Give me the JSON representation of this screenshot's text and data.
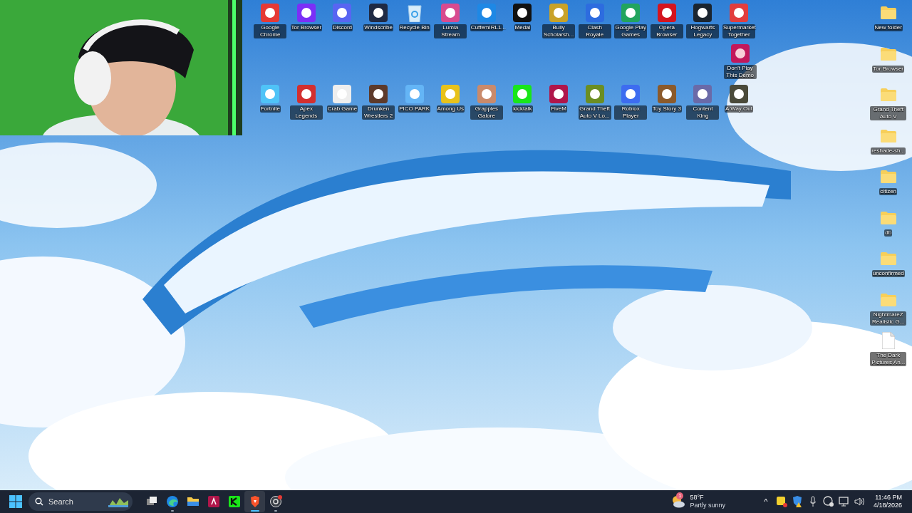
{
  "desktop": {
    "top_row": [
      {
        "label": "Google Chrome",
        "kind": "app"
      },
      {
        "label": "Tor Browser",
        "kind": "app"
      },
      {
        "label": "Discord",
        "kind": "app"
      },
      {
        "label": "Windscribe",
        "kind": "app"
      },
      {
        "label": "Recycle Bin",
        "kind": "recycle"
      },
      {
        "label": "Lumia Stream",
        "kind": "app"
      },
      {
        "label": "CuffemIRL1...",
        "kind": "app"
      },
      {
        "label": "Medal",
        "kind": "app"
      },
      {
        "label": "Bully Scholarsh...",
        "kind": "app"
      },
      {
        "label": "Clash Royale",
        "kind": "app"
      },
      {
        "label": "Google Play Games",
        "kind": "app"
      },
      {
        "label": "Opera Browser",
        "kind": "app"
      },
      {
        "label": "Hogwarts Legacy",
        "kind": "app"
      },
      {
        "label": "Supermarket Together",
        "kind": "app"
      }
    ],
    "middle_row": [
      {
        "label": "Don't Play This Demo",
        "kind": "app"
      }
    ],
    "bottom_row": [
      {
        "label": "Fortnite",
        "kind": "app"
      },
      {
        "label": "Apex Legends",
        "kind": "app"
      },
      {
        "label": "Crab Game",
        "kind": "app"
      },
      {
        "label": "Drunken Wrestlers 2",
        "kind": "app"
      },
      {
        "label": "PICO PARK",
        "kind": "app"
      },
      {
        "label": "Among Us",
        "kind": "app"
      },
      {
        "label": "Grapples Galore",
        "kind": "app"
      },
      {
        "label": "kicktalk",
        "kind": "app"
      },
      {
        "label": "FiveM",
        "kind": "app"
      },
      {
        "label": "Grand Theft Auto V Lo...",
        "kind": "app"
      },
      {
        "label": "Roblox Player",
        "kind": "app"
      },
      {
        "label": "Toy Story 3",
        "kind": "app"
      },
      {
        "label": "Content King",
        "kind": "app"
      },
      {
        "label": "A Way Out",
        "kind": "app"
      }
    ],
    "right_column": [
      {
        "label": "New folder",
        "kind": "folder"
      },
      {
        "label": "Tor Browser",
        "kind": "folder"
      },
      {
        "label": "Grand Theft Auto V",
        "kind": "folder"
      },
      {
        "label": "reshade-sh...",
        "kind": "folder"
      },
      {
        "label": "citizen",
        "kind": "folder"
      },
      {
        "label": "db",
        "kind": "folder"
      },
      {
        "label": "unconfirmed",
        "kind": "folder"
      },
      {
        "label": "NightmareZ Realistic G...",
        "kind": "folder"
      },
      {
        "label": "The Dark Pictures An...",
        "kind": "file"
      }
    ]
  },
  "taskbar": {
    "search": {
      "placeholder": "Search"
    },
    "apps": [
      {
        "kind": "taskview",
        "running": false,
        "active": false
      },
      {
        "kind": "edge",
        "running": true,
        "active": false
      },
      {
        "kind": "explorer",
        "running": false,
        "active": false
      },
      {
        "kind": "fivem",
        "running": false,
        "active": false
      },
      {
        "kind": "kick",
        "running": false,
        "active": false
      },
      {
        "kind": "brave",
        "running": true,
        "active": true
      },
      {
        "kind": "obs",
        "running": true,
        "active": false
      }
    ],
    "weather": {
      "badge": "1",
      "temperature": "58°F",
      "condition": "Partly sunny"
    },
    "tray_chevron": "^",
    "time": "11:46 PM",
    "date": "4/18/2026"
  }
}
